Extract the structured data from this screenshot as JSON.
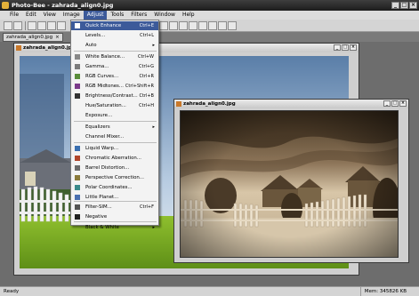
{
  "window": {
    "title": "Photo-Bee - zahrada_align0.jpg",
    "minimize": "_",
    "maximize": "□",
    "close": "×"
  },
  "menubar": [
    "File",
    "Edit",
    "View",
    "Image",
    "Adjust",
    "Tools",
    "Filters",
    "Window",
    "Help"
  ],
  "tabs": [
    {
      "label": "zahrada_align0.jpg",
      "close": "×"
    }
  ],
  "doc_window_1": {
    "title": "zahrada_align0.jpg",
    "minimize": "_",
    "maximize": "□",
    "close": "×"
  },
  "doc_window_2": {
    "title": "zahrada_align0.jpg",
    "minimize": "_",
    "maximize": "□",
    "close": "×"
  },
  "adjust_menu": {
    "items": [
      {
        "label": "Quick Enhance",
        "shortcut": "Ctrl+E"
      },
      {
        "label": "Levels...",
        "shortcut": "Ctrl+L"
      },
      {
        "label": "Auto",
        "submenu": "▸"
      },
      {
        "label": "White Balance...",
        "shortcut": "Ctrl+W"
      },
      {
        "label": "Gamma...",
        "shortcut": "Ctrl+G"
      },
      {
        "label": "RGB Curves...",
        "shortcut": "Ctrl+R"
      },
      {
        "label": "RGB Midtones...",
        "shortcut": "Ctrl+Shift+R"
      },
      {
        "label": "Brightness/Contrast...",
        "shortcut": "Ctrl+B"
      },
      {
        "label": "Hue/Saturation...",
        "shortcut": "Ctrl+H"
      },
      {
        "label": "Exposure...",
        "shortcut": ""
      },
      {
        "label": "Equalizers",
        "submenu": "▸"
      },
      {
        "label": "Channel Mixer...",
        "shortcut": ""
      },
      {
        "label": "Liquid Warp...",
        "shortcut": ""
      },
      {
        "label": "Chromatic Aberration...",
        "shortcut": ""
      },
      {
        "label": "Barrel Distortion...",
        "shortcut": ""
      },
      {
        "label": "Perspective Correction...",
        "shortcut": ""
      },
      {
        "label": "Polar Coordinates...",
        "shortcut": ""
      },
      {
        "label": "Little Planet...",
        "shortcut": ""
      },
      {
        "label": "Filter-SIM...",
        "shortcut": "Ctrl+F"
      },
      {
        "label": "Negative",
        "shortcut": ""
      },
      {
        "label": "Black & White",
        "submenu": "▸"
      }
    ]
  },
  "statusbar": {
    "left": "Ready",
    "right": "Mem: 345826 KB"
  },
  "colors": {
    "highlight": "#3c5a9a",
    "workspace": "#6d6d6d",
    "titlebar": "#1c1c1c"
  }
}
